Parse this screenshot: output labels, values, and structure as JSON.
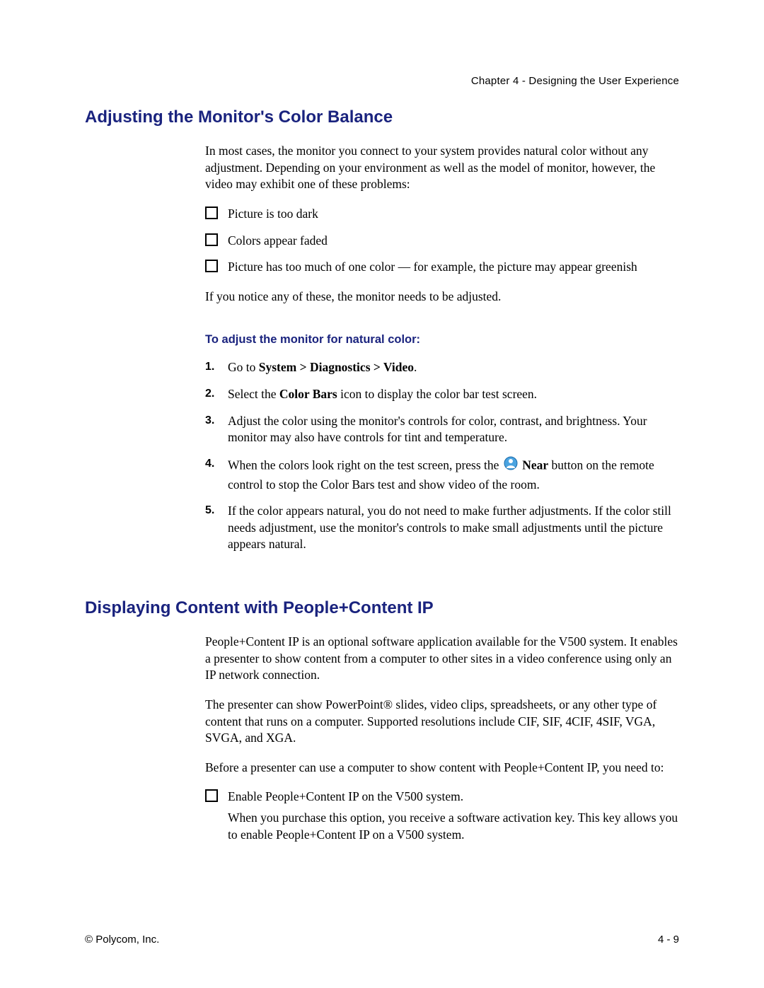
{
  "header": {
    "chapter_line": "Chapter 4 - Designing the User Experience"
  },
  "section1": {
    "heading": "Adjusting the Monitor's Color Balance",
    "intro": "In most cases, the monitor you connect to your system provides natural color without any adjustment. Depending on your environment as well as the model of monitor, however, the video may exhibit one of these problems:",
    "problems": [
      "Picture is too dark",
      "Colors appear faded",
      "Picture has too much of one color — for example, the picture may appear greenish"
    ],
    "after_problems": "If you notice any of these, the monitor needs to be adjusted.",
    "procedure_heading": "To adjust the monitor for natural color:",
    "steps": {
      "s1_pre": "Go to ",
      "s1_bold": "System > Diagnostics > Video",
      "s1_post": ".",
      "s2_pre": "Select the ",
      "s2_bold": "Color Bars",
      "s2_post": " icon to display the color bar test screen.",
      "s3": "Adjust the color using the monitor's controls for color, contrast, and brightness. Your monitor may also have controls for tint and temperature.",
      "s4_pre": "When the colors look right on the test screen, press the ",
      "s4_bold": "Near",
      "s4_post": " button on the remote control to stop the Color Bars test and show video of the room.",
      "s5": "If the color appears natural, you do not need to make further adjustments. If the color still needs adjustment, use the monitor's controls to make small adjustments until the picture appears natural."
    }
  },
  "section2": {
    "heading": "Displaying Content with People+Content IP",
    "p1": "People+Content IP is an optional software application available for the V500 system. It enables a presenter to show content from a computer to other sites in a video conference using only an IP network connection.",
    "p2": "The presenter can show PowerPoint® slides, video clips, spreadsheets, or any other type of content that runs on a computer. Supported resolutions include CIF, SIF, 4CIF, 4SIF, VGA, SVGA, and XGA.",
    "p3": "Before a presenter can use a computer to show content with People+Content IP, you need to:",
    "checklist": {
      "item1": "Enable People+Content IP on the V500 system.",
      "item1_sub": "When you purchase this option, you receive a software activation key. This key allows you to enable People+Content IP on a V500 system."
    }
  },
  "footer": {
    "copyright": "© Polycom, Inc.",
    "page_number": "4 - 9"
  }
}
